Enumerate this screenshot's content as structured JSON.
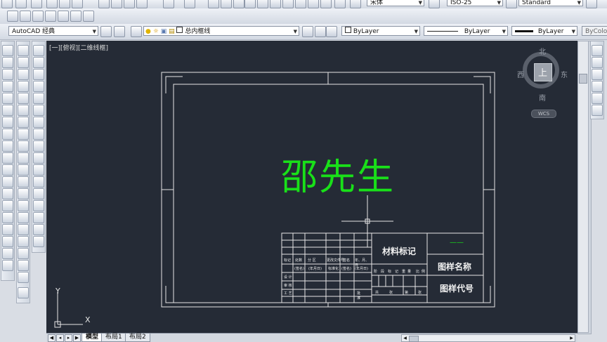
{
  "toolbar": {
    "font_combo": "宋体",
    "dimstyle_combo": "ISO-25",
    "tablestyle_combo": "Standard",
    "workspace_combo": "AutoCAD 经典",
    "layer_combo": "总内框线",
    "color_combo": "ByLayer",
    "linetype_combo": "ByLayer",
    "lineweight_combo": "ByLayer",
    "plotstyle_combo": "ByColo"
  },
  "viewport": {
    "label": "[一][俯视][二维线框]"
  },
  "viewcube": {
    "north": "北",
    "south": "南",
    "east": "东",
    "west": "西",
    "top": "上",
    "wcs": "WCS"
  },
  "drawing": {
    "big_text": "邵先生",
    "title_block": {
      "material_mark": "材料标记",
      "dash": "——",
      "drawing_name": "图样名称",
      "drawing_code": "图样代号",
      "small_headers_row1": [
        "标记",
        "处数",
        "分 区",
        "更改文件号",
        "签名",
        "年、月、日"
      ],
      "small_headers_row2": [
        "(签名)",
        "(年月日)",
        "标准化",
        "(签名)",
        "(年月日)"
      ],
      "row_labels": [
        "设 计",
        "审 核",
        "工 艺"
      ],
      "stage_labels": [
        "阶",
        "段",
        "标",
        "记",
        "重",
        "量",
        "比",
        "例"
      ],
      "sheet_labels": [
        "共",
        "张",
        "第",
        "张"
      ],
      "approve_label": "批 准"
    },
    "ucs": {
      "x": "X",
      "y": "Y"
    }
  },
  "tabs": {
    "model": "模型",
    "layout1": "布局1",
    "layout2": "布局2"
  },
  "colors": {
    "canvas_bg": "#252b36",
    "line_white": "#e6e6e6",
    "text_green": "#19e019"
  }
}
